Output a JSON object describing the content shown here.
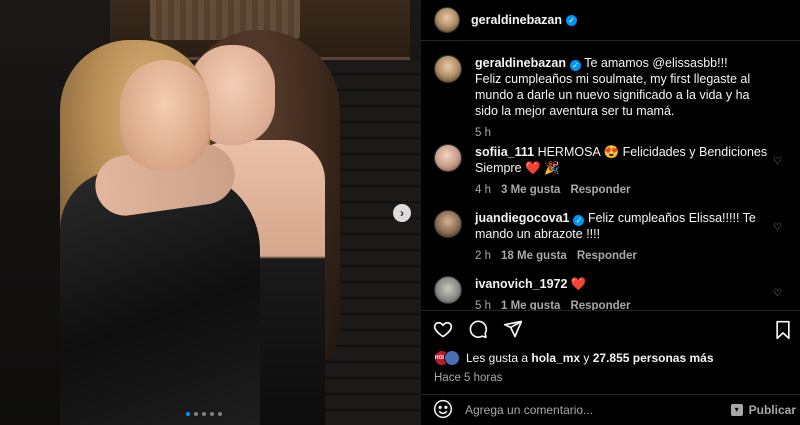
{
  "post": {
    "author": "geraldinebazan",
    "verified": true
  },
  "media": {
    "carousel_dots": 5,
    "active_dot": 0,
    "next_icon": "chevron-right-icon"
  },
  "caption": {
    "author": "geraldinebazan",
    "mention_line": "Te amamos @elissasbb!!!",
    "text": "Feliz cumpleaños mi soulmate, my first llegaste al mundo a darle un nuevo significado a la vida y ha sido la mejor aventura ser tu mamá.",
    "time": "5 h"
  },
  "comments": [
    {
      "user": "sofiia_111",
      "text": "HERMOSA 😍 Felicidades y Bendiciones Siempre ❤️ 🎉",
      "time": "4 h",
      "likes": "3 Me gusta",
      "reply": "Responder"
    },
    {
      "user": "juandiegocova1",
      "verified": true,
      "text": "Feliz cumpleaños Elissa!!!!! Te mando un abrazote !!!!",
      "time": "2 h",
      "likes": "18 Me gusta",
      "reply": "Responder"
    },
    {
      "user": "ivanovich_1972",
      "text": "❤️",
      "time": "5 h",
      "likes": "1 Me gusta",
      "reply": "Responder"
    }
  ],
  "actions": {
    "like_icon": "heart-icon",
    "comment_icon": "comment-icon",
    "share_icon": "share-icon",
    "save_icon": "bookmark-icon"
  },
  "likes": {
    "prefix": "Les gusta a ",
    "first_user": "hola_mx",
    "middle": " y ",
    "others": "27.855 personas más",
    "avatar_label": "HOLA"
  },
  "time_ago": "Hace 5 horas",
  "composer": {
    "placeholder": "Agrega un comentario...",
    "publish": "Publicar"
  }
}
